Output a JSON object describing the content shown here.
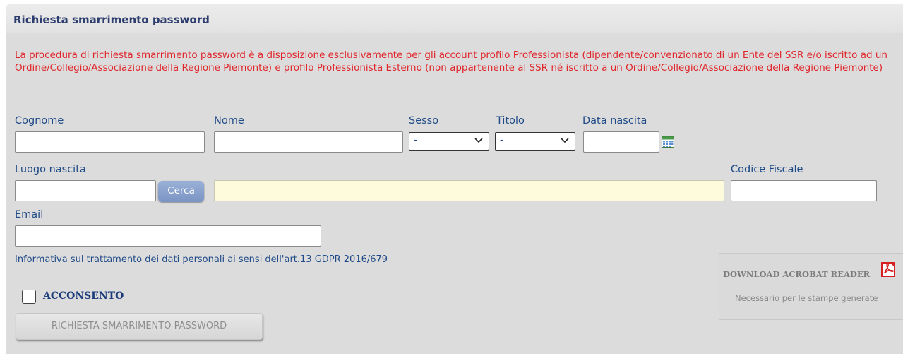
{
  "header": {
    "title": "Richiesta smarrimento password"
  },
  "notice": "La procedura di richiesta smarrimento password è a disposizione esclusivamente per gli account profilo Professionista (dipendente/convenzionato di un Ente del SSR e/o iscritto ad un Ordine/Collegio/Associazione della Regione Piemonte) e profilo Professionista Esterno (non appartenente al SSR né iscritto a un Ordine/Collegio/Associazione della Regione Piemonte)",
  "form": {
    "cognome": {
      "label": "Cognome",
      "value": ""
    },
    "nome": {
      "label": "Nome",
      "value": ""
    },
    "sesso": {
      "label": "Sesso",
      "selected": "-"
    },
    "titolo": {
      "label": "Titolo",
      "selected": "-"
    },
    "data_nascita": {
      "label": "Data nascita",
      "value": ""
    },
    "luogo_nascita": {
      "label": "Luogo nascita",
      "value": "",
      "search_button": "Cerca",
      "result_value": ""
    },
    "codice_fiscale": {
      "label": "Codice Fiscale",
      "value": ""
    },
    "email": {
      "label": "Email",
      "value": ""
    }
  },
  "privacy": {
    "info_text": "Informativa sul trattamento dei dati personali ai sensi dell'art.13 GDPR 2016/679",
    "consent_label": "ACCONSENTO",
    "consent_checked": false
  },
  "submit_button": "RICHIESTA SMARRIMENTO PASSWORD",
  "acrobat": {
    "title": "DOWNLOAD ACROBAT READER",
    "note": "Necessario per le stampe generate",
    "icon": "pdf-icon"
  },
  "colors": {
    "panel_bg": "#dcdcdc",
    "title_color": "#2c3d6e",
    "notice_color": "#e0262b",
    "label_color": "#1e4a87",
    "search_result_bg": "#fdfbdc"
  }
}
